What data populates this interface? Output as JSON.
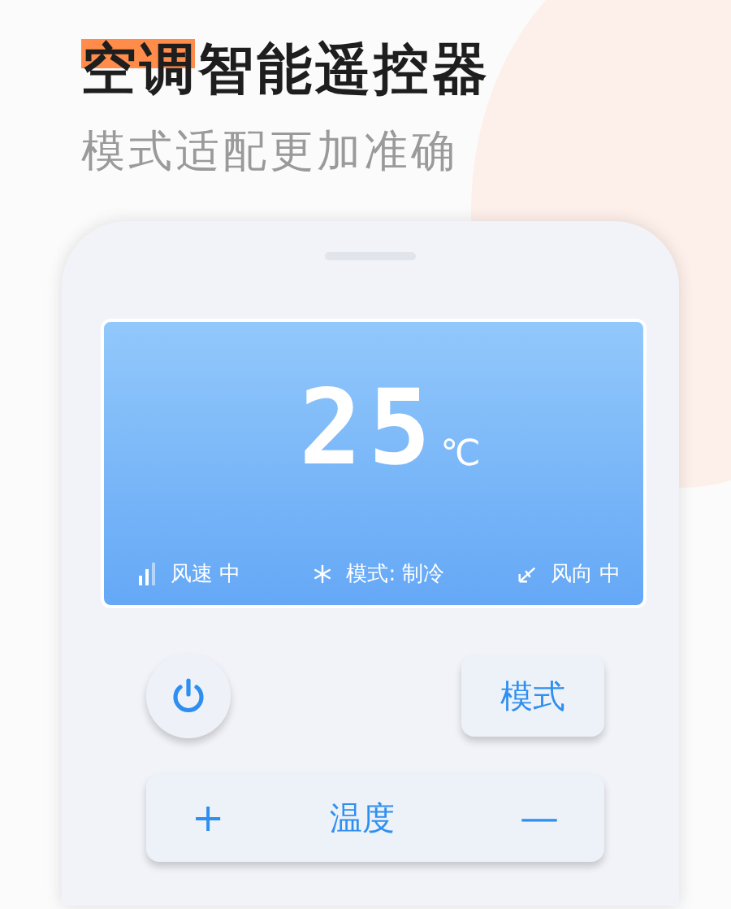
{
  "headline": {
    "title": "空调智能遥控器",
    "subtitle": "模式适配更加准确"
  },
  "display": {
    "temperature": "25",
    "unit": "℃",
    "status": [
      {
        "kind": "fan",
        "text": "风速 中"
      },
      {
        "kind": "mode",
        "text": "模式: 制冷"
      },
      {
        "kind": "swing",
        "text": "风向 中"
      }
    ]
  },
  "controls": {
    "mode_button": "模式",
    "temperature": {
      "plus": "+",
      "label": "温度",
      "minus": "—"
    }
  }
}
